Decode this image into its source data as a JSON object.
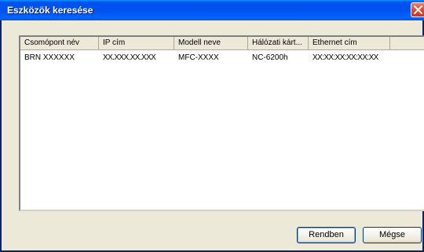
{
  "window": {
    "title": "Eszközök keresése"
  },
  "list": {
    "columns": [
      "Csomópont név",
      "IP cím",
      "Modell neve",
      "Hálózati kárt...",
      "Ethernet cím"
    ],
    "rows": [
      [
        "BRN XXXXXX",
        "XX.XXX.XX.XXX",
        "MFC-XXXX",
        "NC-6200h",
        "XX:XX:XX:XX:XX:XX"
      ]
    ]
  },
  "buttons": {
    "ok_label": "Rendben",
    "cancel_label": "Mégse"
  },
  "icons": {
    "close": "close-icon"
  }
}
